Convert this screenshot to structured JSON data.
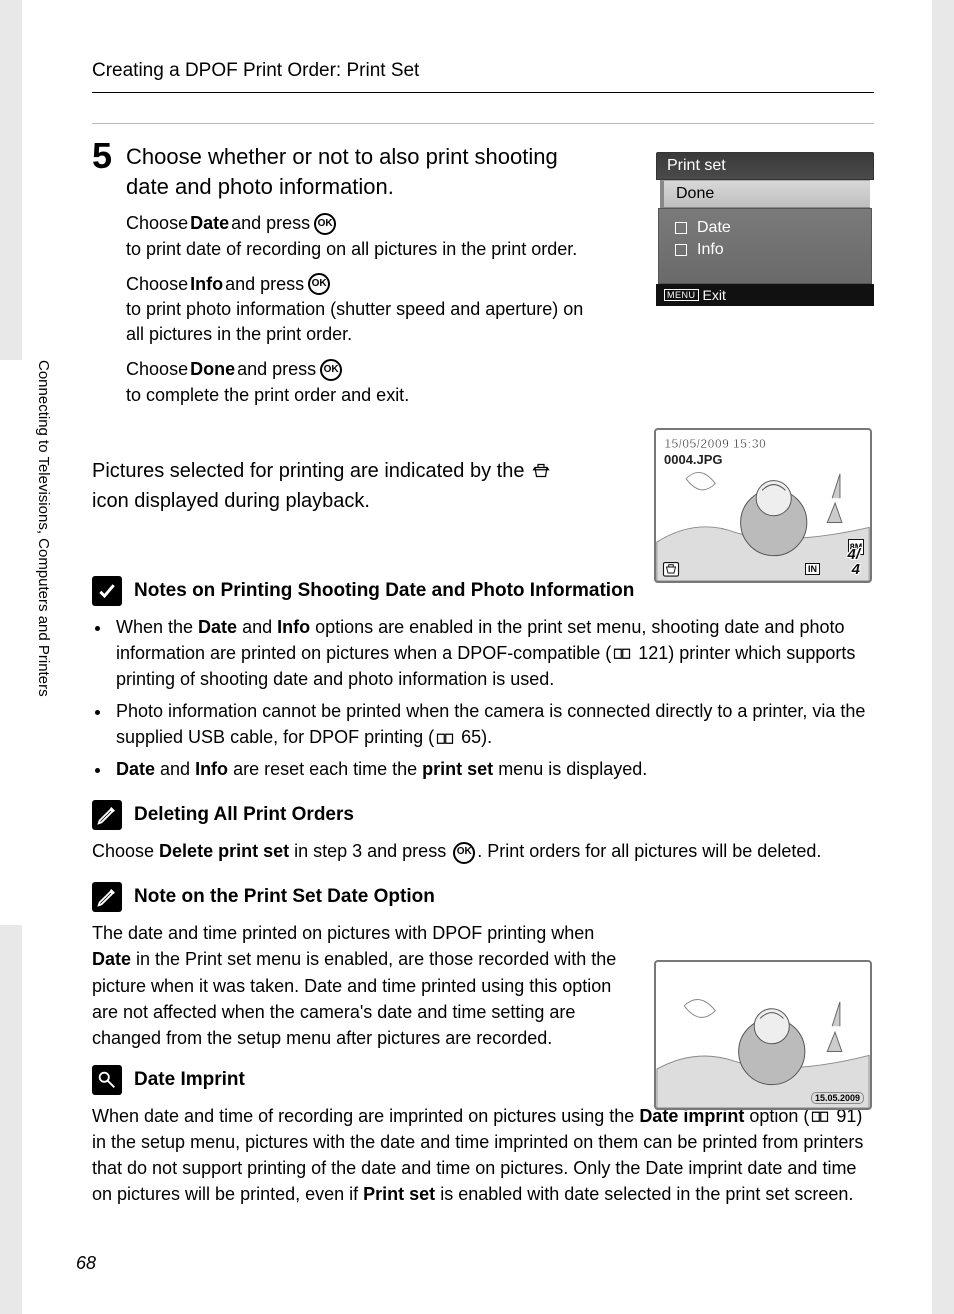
{
  "header": "Creating a DPOF Print Order: Print Set",
  "sidebar_label": "Connecting to Televisions, Computers and Printers",
  "page_number": "68",
  "step": {
    "num": "5",
    "title": "Choose whether or not to also print shooting date and photo information.",
    "p1a": "Choose ",
    "p1b": "Date",
    "p1c": " and press ",
    "p1d": " to print date of recording on all pictures in the print order.",
    "p2a": "Choose ",
    "p2b": "Info",
    "p2c": " and press ",
    "p2d": " to print photo information (shutter speed and aperture) on all pictures in the print order.",
    "p3a": "Choose ",
    "p3b": "Done",
    "p3c": " and press ",
    "p3d": " to complete the print order and exit."
  },
  "playback_para_a": "Pictures selected for printing are indicated by the ",
  "playback_para_b": " icon displayed during playback.",
  "screen1": {
    "title": "Print set",
    "done": "Done",
    "date": "Date",
    "info": "Info",
    "menu": "MENU",
    "exit": "Exit"
  },
  "lcd1": {
    "date": "15/05/2009 15:30",
    "file": "0004.JPG",
    "cur": "4",
    "total": "4",
    "res": "8M",
    "in": "IN"
  },
  "lcd2": {
    "date": "15.05.2009"
  },
  "notes1": {
    "title": "Notes on Printing Shooting Date and Photo Information",
    "li1a": "When the ",
    "li1b": "Date",
    "li1c": " and ",
    "li1d": "Info",
    "li1e": " options are enabled in the print set menu, shooting date and photo information are printed on pictures when a DPOF-compatible (",
    "li1f": " 121) printer which supports printing of shooting date and photo information is used.",
    "li2a": "Photo information cannot be printed when the camera is connected directly to a printer, via the supplied USB cable, for DPOF printing (",
    "li2b": " 65).",
    "li3a": "Date",
    "li3b": " and ",
    "li3c": "Info",
    "li3d": " are reset each time the ",
    "li3e": "print set",
    "li3f": " menu is displayed."
  },
  "notes2": {
    "title": "Deleting All Print Orders",
    "ta": "Choose ",
    "tb": "Delete print set",
    "tc": " in step 3 and press ",
    "td": ". Print orders for all pictures will be deleted."
  },
  "notes3": {
    "title": "Note on the Print Set Date Option",
    "ta": "The date and time printed on pictures with DPOF printing when ",
    "tb": "Date",
    "tc": " in the Print set menu is enabled, are those recorded with the picture when it was taken. Date and time printed using this option are not affected when the camera's date and time setting are changed from the setup menu after pictures are recorded."
  },
  "notes4": {
    "title": "Date Imprint",
    "ta": "When date and time of recording are imprinted on pictures using the ",
    "tb": "Date imprint",
    "tc": " option (",
    "td": " 91) in the setup menu, pictures with the date and time imprinted on them can be printed from printers that do not support printing of the date and time on pictures. Only the Date imprint date and time on pictures will be printed, even if ",
    "te": "Print set",
    "tf": " is enabled with date selected in the print set screen."
  },
  "ok": "OK"
}
